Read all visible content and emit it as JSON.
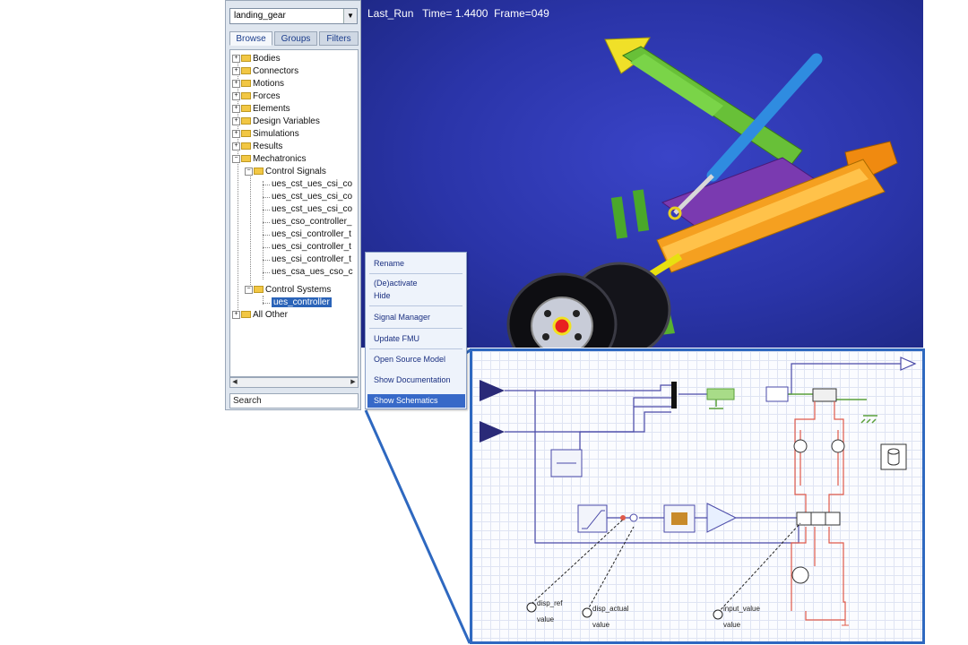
{
  "sidebar": {
    "model_select": "landing_gear",
    "tabs": [
      "Browse",
      "Groups",
      "Filters"
    ],
    "tree": [
      {
        "label": "Bodies"
      },
      {
        "label": "Connectors"
      },
      {
        "label": "Motions"
      },
      {
        "label": "Forces"
      },
      {
        "label": "Elements"
      },
      {
        "label": "Design Variables"
      },
      {
        "label": "Simulations"
      },
      {
        "label": "Results"
      },
      {
        "label": "Mechatronics"
      },
      {
        "label": "Control Signals"
      },
      {
        "label": "ues_cst_ues_csi_co"
      },
      {
        "label": "ues_cst_ues_csi_co"
      },
      {
        "label": "ues_cst_ues_csi_co"
      },
      {
        "label": "ues_cso_controller_"
      },
      {
        "label": "ues_csi_controller_t"
      },
      {
        "label": "ues_csi_controller_t"
      },
      {
        "label": "ues_csi_controller_t"
      },
      {
        "label": "ues_csa_ues_cso_c"
      },
      {
        "label": "Control Systems"
      },
      {
        "label": "ues_controller"
      },
      {
        "label": "All Other"
      }
    ],
    "search_placeholder": "Search"
  },
  "viewport": {
    "header": "Last_Run   Time= 1.4400  Frame=049",
    "background_color": "#2a34a8"
  },
  "context_menu": {
    "items": [
      "Rename",
      "(De)activate",
      "Hide",
      "Signal Manager",
      "Update FMU",
      "Open Source Model",
      "Show Documentation",
      "Show Schematics"
    ],
    "highlighted": "Show Schematics"
  },
  "schematic": {
    "labels": [
      "disp_ref",
      "value",
      "disp_actual",
      "value",
      "input_value",
      "value"
    ],
    "colors": {
      "signal": "#4a4aa8",
      "mechanical": "#5aa03a",
      "hydraulic": "#e05a4a",
      "frame": "#2e68c0"
    }
  }
}
